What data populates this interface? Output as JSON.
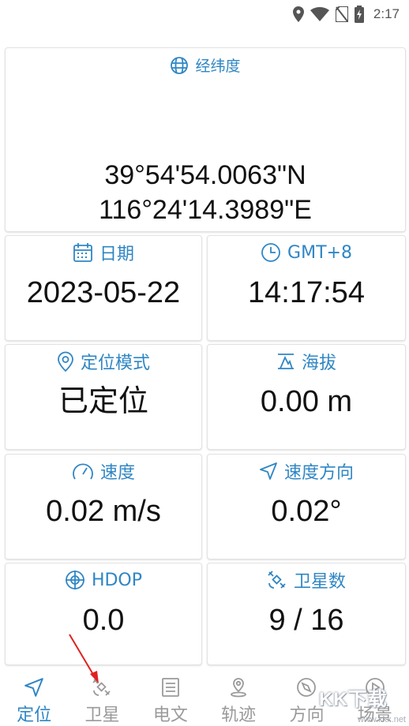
{
  "status_bar": {
    "time": "2:17",
    "icons": [
      "location-icon",
      "wifi-icon",
      "no-sim-icon",
      "battery-charging-icon"
    ]
  },
  "lat_lng": {
    "title": "经纬度",
    "icon": "globe-icon",
    "latitude": "39°54'54.0063\"N",
    "longitude": "116°24'14.3989\"E"
  },
  "date": {
    "title": "日期",
    "icon": "calendar-icon",
    "value": "2023-05-22"
  },
  "time": {
    "title": "GMT+8",
    "icon": "clock-icon",
    "value": "14:17:54"
  },
  "mode": {
    "title": "定位模式",
    "icon": "location-pin-icon",
    "value": "已定位"
  },
  "altitude": {
    "title": "海拔",
    "icon": "altitude-icon",
    "value": "0.00 m"
  },
  "speed": {
    "title": "速度",
    "icon": "speedometer-icon",
    "value": "0.02 m/s"
  },
  "bearing": {
    "title": "速度方向",
    "icon": "navigation-arrow-icon",
    "value": "0.02°"
  },
  "hdop": {
    "title": "HDOP",
    "icon": "crosshair-icon",
    "value": "0.0"
  },
  "satellites": {
    "title": "卫星数",
    "icon": "satellite-icon",
    "value": "9 / 16"
  },
  "bottom_nav": {
    "items": [
      {
        "label": "定位",
        "icon": "navigation-arrow-icon",
        "active": true
      },
      {
        "label": "卫星",
        "icon": "satellite-icon",
        "active": false
      },
      {
        "label": "电文",
        "icon": "document-icon",
        "active": false
      },
      {
        "label": "轨迹",
        "icon": "map-pin-icon",
        "active": false
      },
      {
        "label": "方向",
        "icon": "compass-icon",
        "active": false
      },
      {
        "label": "场景",
        "icon": "scene-icon",
        "active": false
      }
    ]
  },
  "watermark": {
    "text": "KK下载",
    "sub": "www.kkx.net"
  },
  "colors": {
    "accent": "#2f86c4",
    "inactive": "#9a9a9a",
    "annotation": "#e02020"
  }
}
